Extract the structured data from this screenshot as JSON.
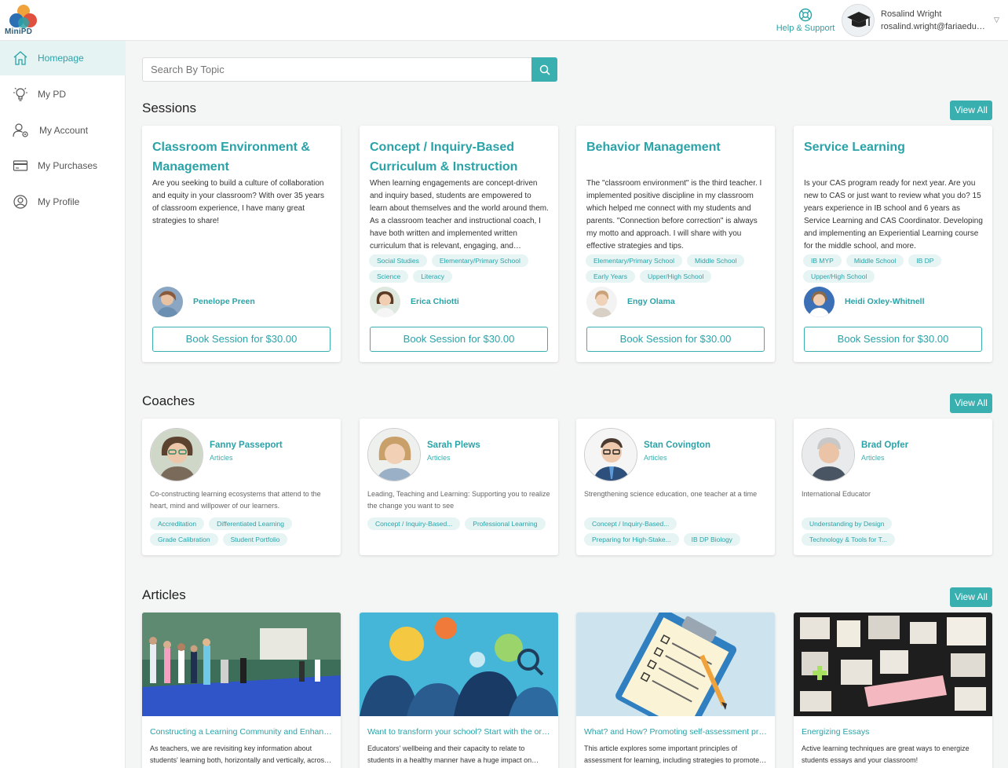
{
  "app": {
    "logo_text": "MiniPD"
  },
  "header": {
    "help_label": "Help & Support",
    "user_name": "Rosalind Wright",
    "user_email": "rosalind.wright@fariaedu.com"
  },
  "sidebar": {
    "items": [
      {
        "label": "Homepage",
        "icon": "home-icon"
      },
      {
        "label": "My PD",
        "icon": "lightbulb-icon"
      },
      {
        "label": "My Account",
        "icon": "user-gear-icon"
      },
      {
        "label": "My Purchases",
        "icon": "credit-card-icon"
      },
      {
        "label": "My Profile",
        "icon": "profile-icon"
      }
    ]
  },
  "search": {
    "placeholder": "Search By Topic"
  },
  "sessions": {
    "title": "Sessions",
    "view_all": "View All",
    "cards": [
      {
        "title": "Classroom Environment & Management",
        "description": "Are you seeking to build a culture of collaboration and equity in your classroom? With over 35 years of classroom experience, I have many great strategies to share!",
        "tags": [],
        "coach": "Penelope Preen",
        "button": "Book Session for $30.00"
      },
      {
        "title": "Concept / Inquiry-Based Curriculum & Instruction",
        "description": "When learning engagements are concept-driven and inquiry based, students are empowered to learn about themselves and the world around them. As a classroom teacher and instructional coach, I have both written and implemented written curriculum that is relevant, engaging, and meaningful.",
        "tags": [
          "Social Studies",
          "Elementary/Primary School",
          "Science",
          "Literacy"
        ],
        "coach": "Erica Chiotti",
        "button": "Book Session for $30.00"
      },
      {
        "title": "Behavior Management",
        "description": "The \"classroom environment\" is the third teacher. I implemented positive discipline in my classroom which helped me connect with my students and parents. \"Connection before correction\" is always my motto and approach. I will share with you effective strategies and tips.",
        "tags": [
          "Elementary/Primary School",
          "Middle School",
          "Early Years",
          "Upper/High School"
        ],
        "coach": "Engy Olama",
        "button": "Book Session for $30.00"
      },
      {
        "title": "Service Learning",
        "description": "Is your CAS program ready for next year. Are you new to CAS or just want to review what you do? 15 years experience in IB school and 6 years as Service Learning and CAS Coordinator. Developing and implementing an Experiential Learning course for the middle school, and more.",
        "tags": [
          "IB MYP",
          "Middle School",
          "IB DP",
          "Upper/High School"
        ],
        "coach": "Heidi Oxley-Whitnell",
        "button": "Book Session for $30.00"
      }
    ]
  },
  "coaches": {
    "title": "Coaches",
    "view_all": "View All",
    "cards": [
      {
        "name": "Fanny Passeport",
        "subtitle": "Articles",
        "description": "Co-constructing learning ecosystems that attend to the heart, mind and willpower of our learners.",
        "tags": [
          "Accreditation",
          "Differentiated Learning",
          "Grade Calibration",
          "Student Portfolio"
        ]
      },
      {
        "name": "Sarah Plews",
        "subtitle": "Articles",
        "description": "Leading, Teaching and Learning: Supporting you to realize the change you want to see",
        "tags": [
          "Concept / Inquiry-Based...",
          "Professional Learning"
        ]
      },
      {
        "name": "Stan Covington",
        "subtitle": "Articles",
        "description": "Strengthening science education, one teacher at a time",
        "tags": [
          "Concept / Inquiry-Based...",
          "Preparing for High-Stake...",
          "IB DP Biology"
        ]
      },
      {
        "name": "Brad Opfer",
        "subtitle": "Articles",
        "description": "International Educator",
        "tags": [
          "Understanding by Design",
          "Technology & Tools for T..."
        ]
      }
    ]
  },
  "articles": {
    "title": "Articles",
    "view_all": "View All",
    "cards": [
      {
        "title": "Constructing a Learning Community and Enhancing Students' Learning",
        "description": "As teachers, we are revisiting key information about students' learning both, horizontally and vertically, across the curriculum."
      },
      {
        "title": "Want to transform your school? Start with the organizational culture",
        "description": "Educators' wellbeing and their capacity to relate to students in a healthy manner have a huge impact on learning."
      },
      {
        "title": "What? and How? Promoting self-assessment practices",
        "description": "This article explores some important principles of assessment for learning, including strategies to promote self-assessment."
      },
      {
        "title": "Energizing Essays",
        "description": "Active learning techniques are great ways to energize students essays and your classroom!"
      }
    ]
  },
  "colors": {
    "accent": "#3aafb0",
    "accent_text": "#2aa3a8",
    "tag_bg": "#e6f4f4"
  }
}
